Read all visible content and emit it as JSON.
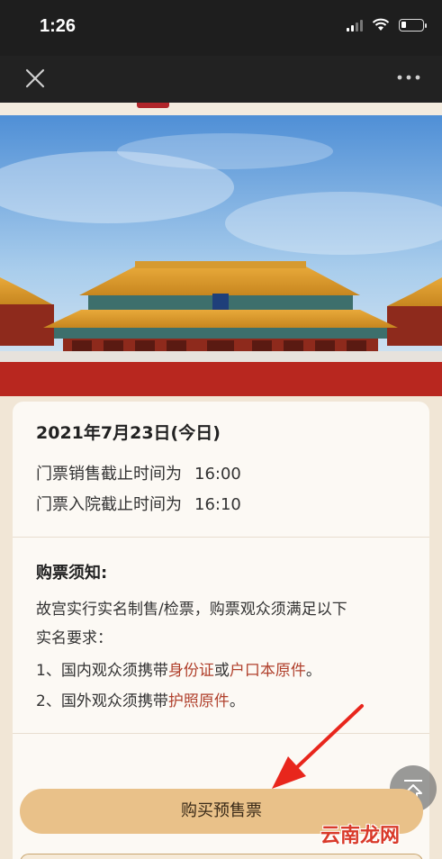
{
  "status_bar": {
    "time": "1:26"
  },
  "card": {
    "date_title": "2021年7月23日(今日)",
    "sales_cutoff_label": "门票销售截止时间为",
    "sales_cutoff_time": "16:00",
    "entry_cutoff_label": "门票入院截止时间为",
    "entry_cutoff_time": "16:10",
    "notice_title": "购票须知:",
    "notice_line1": "故宫实行实名制售/检票，购票观众须满足以下",
    "notice_line2": "实名要求：",
    "rule1_prefix": "1、国内观众须携带",
    "rule1_id": "身份证",
    "rule1_or": "或",
    "rule1_household": "户口本原件",
    "rule1_end": "。",
    "rule2_prefix": "2、国外观众须携带",
    "rule2_passport": "护照原件",
    "rule2_end": "。"
  },
  "buy_button_label": "购买预售票",
  "watermark": "云南龙网",
  "colors": {
    "accent": "#e9c189",
    "highlight": "#b0402c",
    "wall_red": "#b8271f"
  }
}
